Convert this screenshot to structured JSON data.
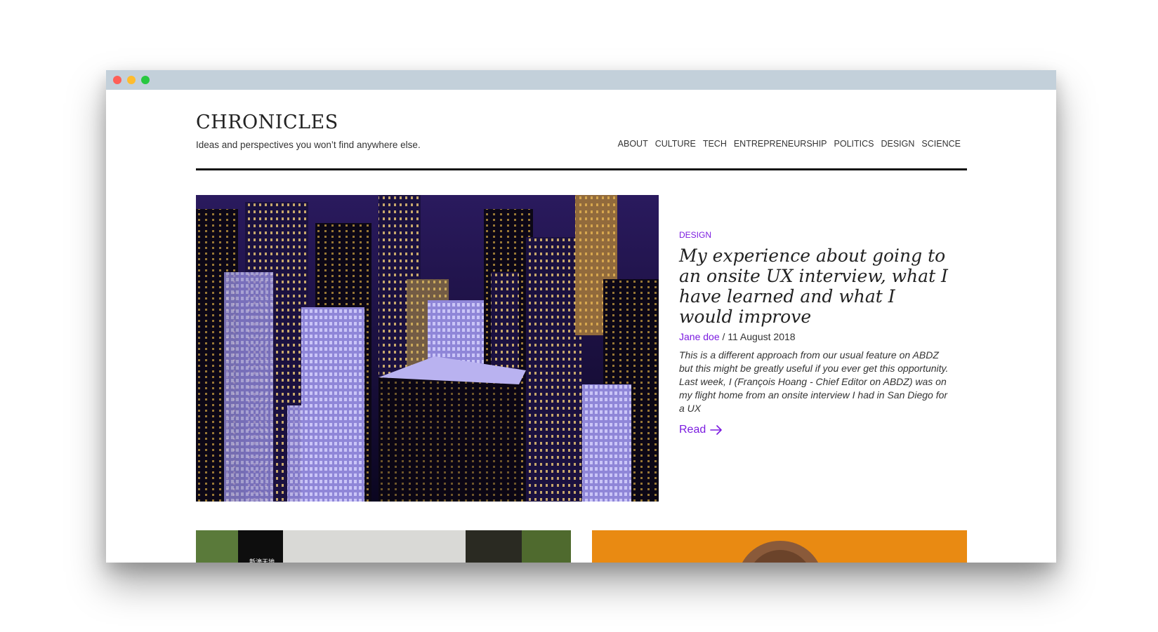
{
  "window": {
    "controls": [
      "close",
      "minimize",
      "zoom"
    ]
  },
  "header": {
    "brand": "CHRONICLES",
    "tagline": "Ideas and perspectives you won’t find anywhere else.",
    "nav": [
      "ABOUT",
      "CULTURE",
      "TECH",
      "ENTREPRENEURSHIP",
      "POLITICS",
      "DESIGN",
      "SCIENCE"
    ]
  },
  "featured": {
    "category": "DESIGN",
    "title": "My experience about going to an onsite UX interview, what I have learned and what I would improve",
    "author": "Jane doe",
    "separator": " / ",
    "date": "11 August 2018",
    "excerpt": "This is a different approach from our usual feature on ABDZ but this might be greatly useful if you ever get this opportunity. Last week, I (François Hoang - Chief Editor on ABDZ) was on my flight home from an onsite interview I had in San Diego for a UX",
    "read_label": "Read",
    "image_icon": "city-night-photo"
  },
  "colors": {
    "accent": "#7b1be0",
    "titlebar": "#c3d0da",
    "card2_bg": "#e98a12"
  }
}
